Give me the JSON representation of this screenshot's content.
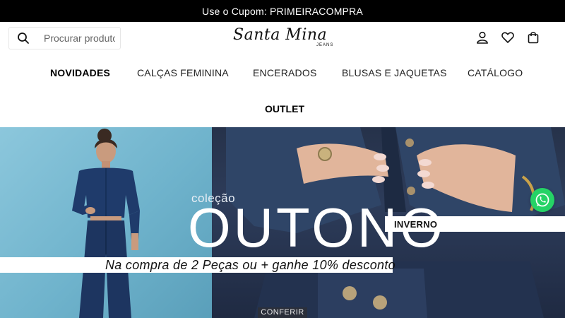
{
  "topbar": {
    "text": "Use o Cupom: PRIMEIRACOMPRA"
  },
  "search": {
    "placeholder": "Procurar produtos"
  },
  "logo": {
    "script": "Santa Mina",
    "sub": "JEANS"
  },
  "header_icons": [
    "user-icon",
    "heart-icon",
    "bag-icon"
  ],
  "nav": {
    "items": [
      {
        "label": "NOVIDADES"
      },
      {
        "label": "CALÇAS FEMININA"
      },
      {
        "label": "ENCERADOS"
      },
      {
        "label": "BLUSAS E JAQUETAS"
      },
      {
        "label": "CATÁLOGO"
      },
      {
        "label": "OUTLET"
      }
    ]
  },
  "banner": {
    "colecao": "coleção",
    "headline": "OUTONO",
    "sub_tag": "INVERNO",
    "promo": "Na compra de 2 Peças ou + ganhe 10% desconto",
    "cta": "CONFERIR"
  },
  "colors": {
    "topbar_bg": "#000000",
    "whatsapp": "#25d366",
    "banner_left": "#7bbad3",
    "banner_right": "#26324a"
  }
}
